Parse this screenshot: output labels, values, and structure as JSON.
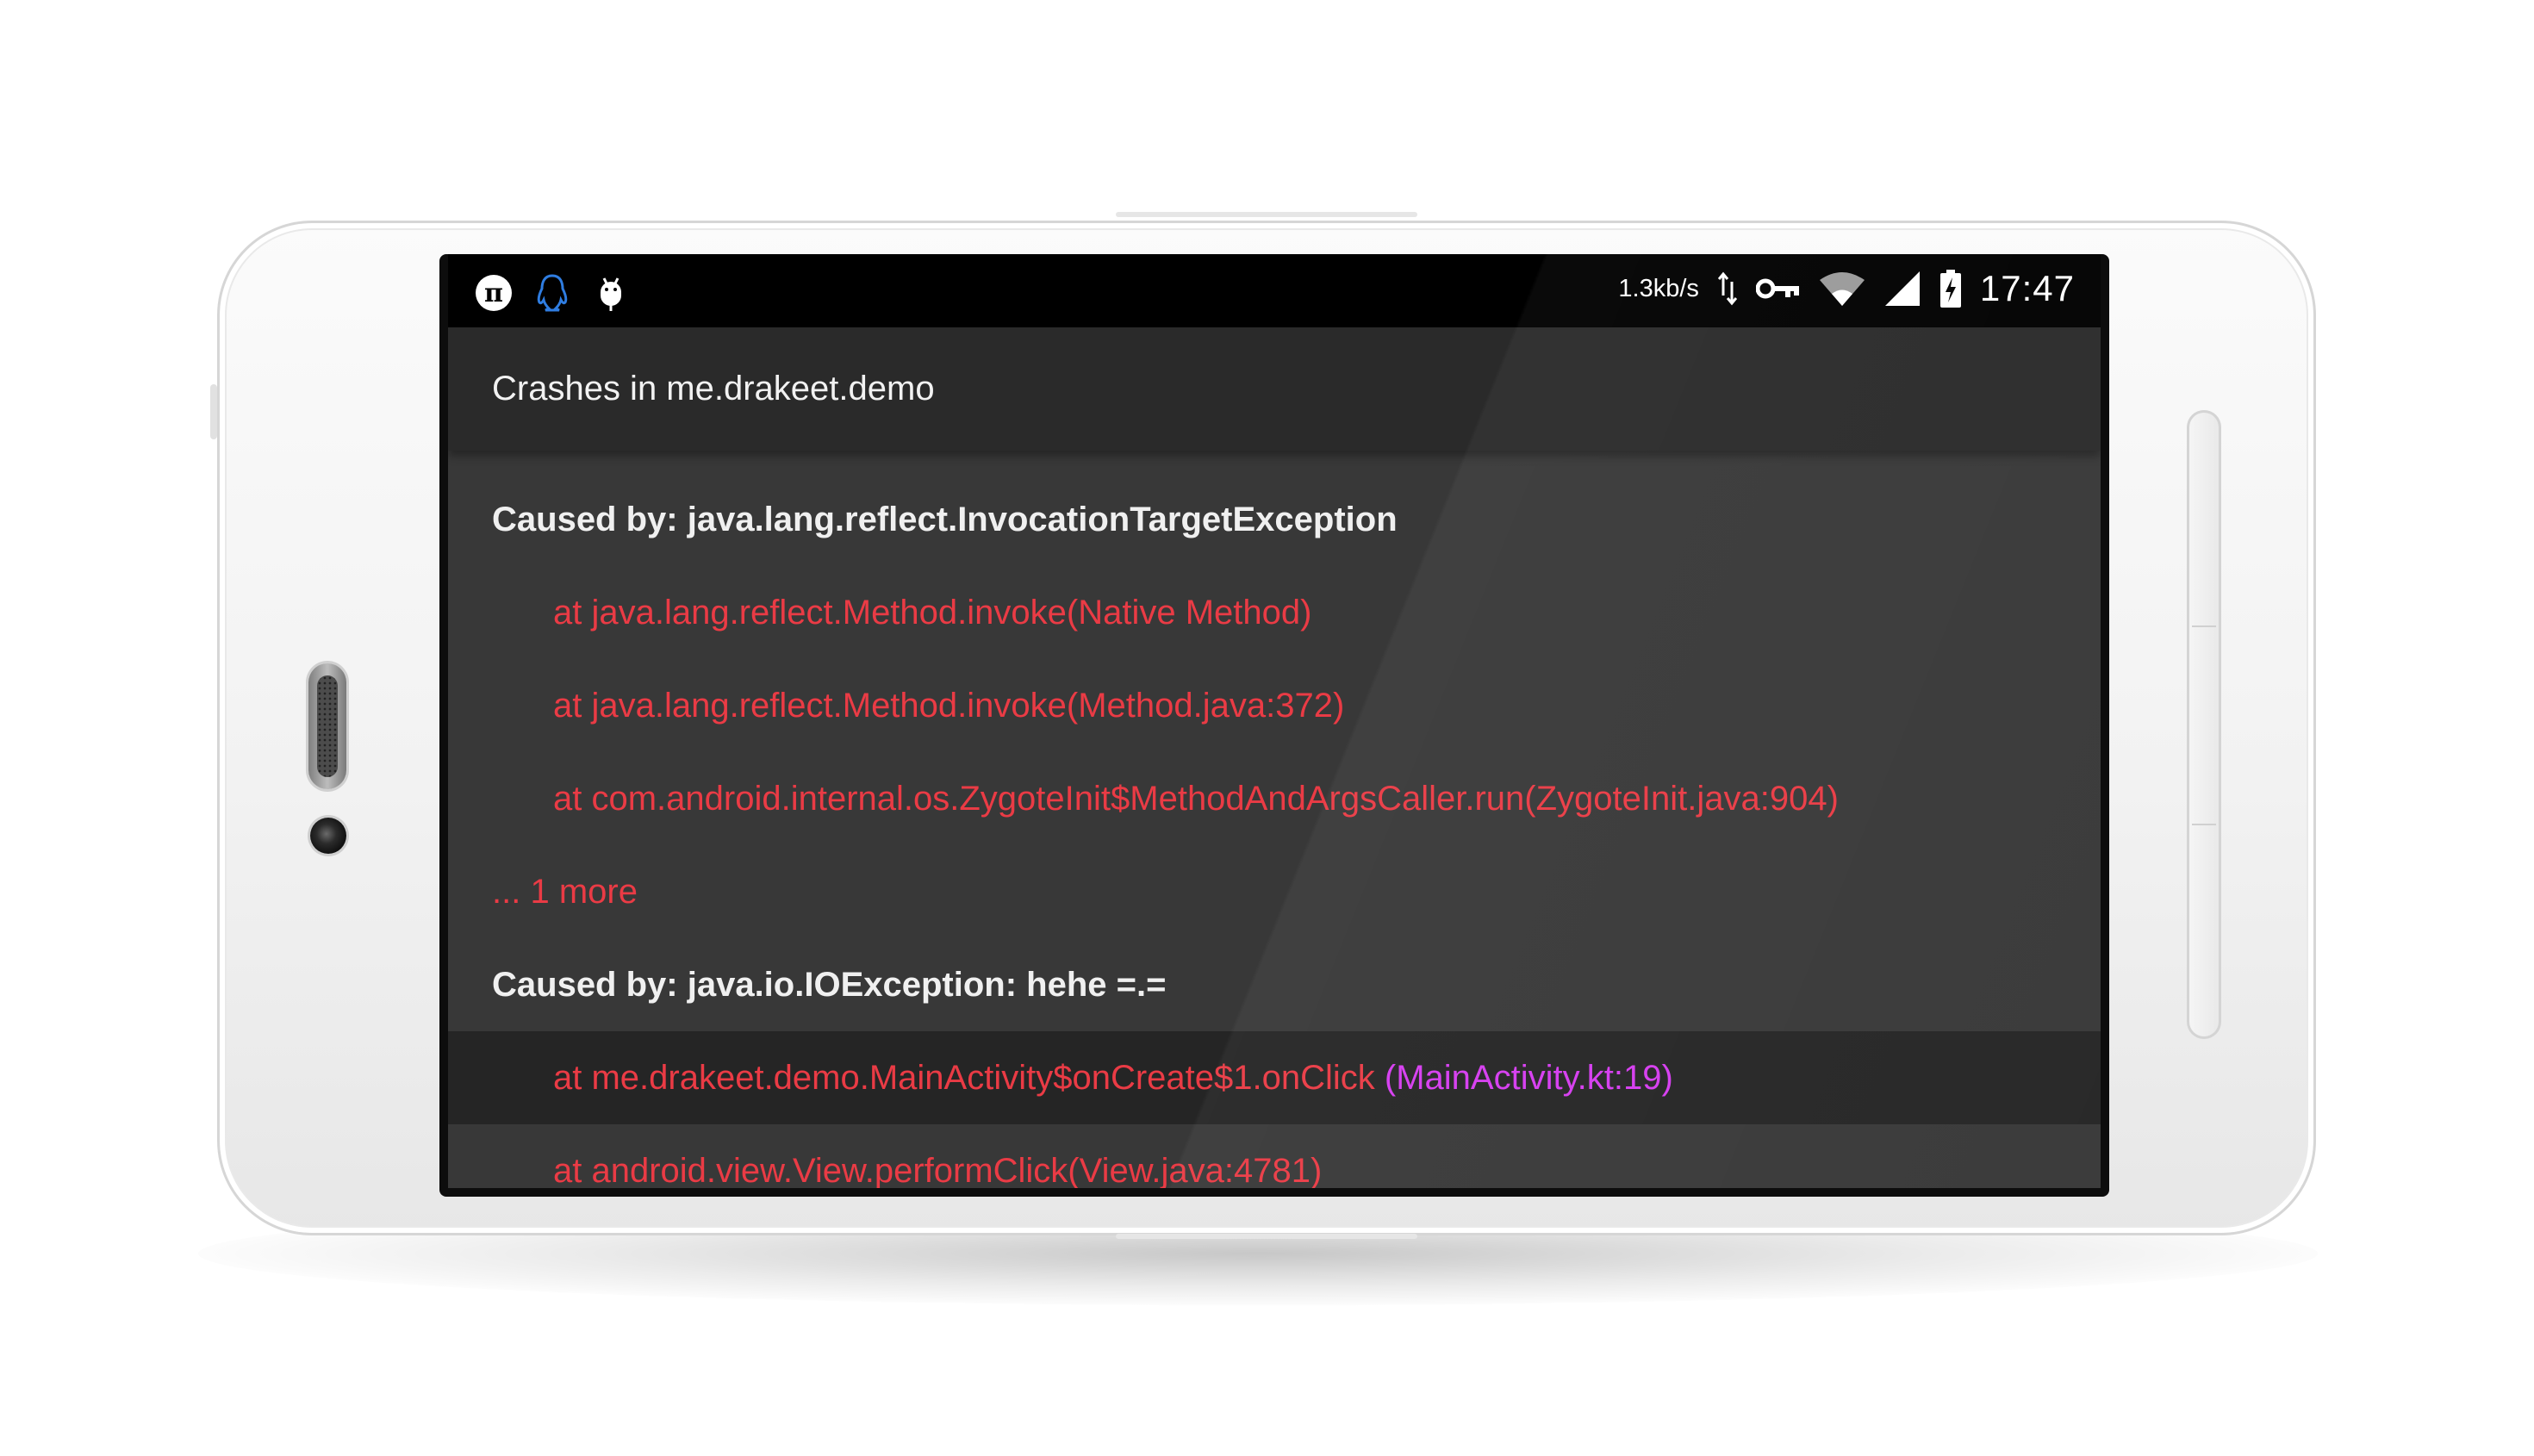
{
  "statusbar": {
    "left_icons": [
      "pi-icon",
      "qq-penguin-icon",
      "android-debug-icon"
    ],
    "net_speed": "1.3kb/s",
    "time": "17:47",
    "right_icons": [
      "data-transfer-icon",
      "vpn-key-icon",
      "wifi-icon",
      "cell-signal-icon",
      "battery-charging-icon"
    ]
  },
  "appbar": {
    "title": "Crashes in me.drakeet.demo"
  },
  "trace": {
    "caused1": "Caused by: java.lang.reflect.InvocationTargetException",
    "frame1": "at java.lang.reflect.Method.invoke(Native Method)",
    "frame2": "at java.lang.reflect.Method.invoke(Method.java:372)",
    "frame3": "at com.android.internal.os.ZygoteInit$MethodAndArgsCaller.run(ZygoteInit.java:904)",
    "more": "... 1 more",
    "caused2": "Caused by: java.io.IOException: hehe =.=",
    "frame4_text": "at me.drakeet.demo.MainActivity$onCreate$1.onClick ",
    "frame4_link": "(MainActivity.kt:19)",
    "frame5": "at android.view.View.performClick(View.java:4781)"
  },
  "colors": {
    "error_red": "#ea3b45",
    "link_magenta": "#d63cf0",
    "background": "#383838",
    "highlight_row": "#252525"
  }
}
